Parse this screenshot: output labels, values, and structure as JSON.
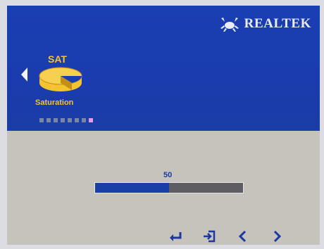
{
  "brand": {
    "name": "REALTEK",
    "logo_icon": "crab-logo-icon"
  },
  "menu": {
    "current_item": {
      "short_label": "SAT",
      "caption": "Saturation",
      "icon": "saturation-icon"
    },
    "nav_left_icon": "triangle-left-icon",
    "page_indicator": {
      "total": 8,
      "active_index": 7
    }
  },
  "slider": {
    "value_text": "50",
    "value": 50,
    "max": 100
  },
  "controls": [
    {
      "name": "enter-icon",
      "label": ""
    },
    {
      "name": "exit-icon",
      "label": ""
    },
    {
      "name": "previous-icon",
      "label": ""
    },
    {
      "name": "next-icon",
      "label": ""
    }
  ],
  "colors": {
    "panel_blue": "#1a3fb2",
    "accent_yellow": "#f4c330",
    "bar_fill": "#1a3ea8",
    "bar_track": "#5d5d62",
    "control_blue": "#1b3aa1"
  }
}
